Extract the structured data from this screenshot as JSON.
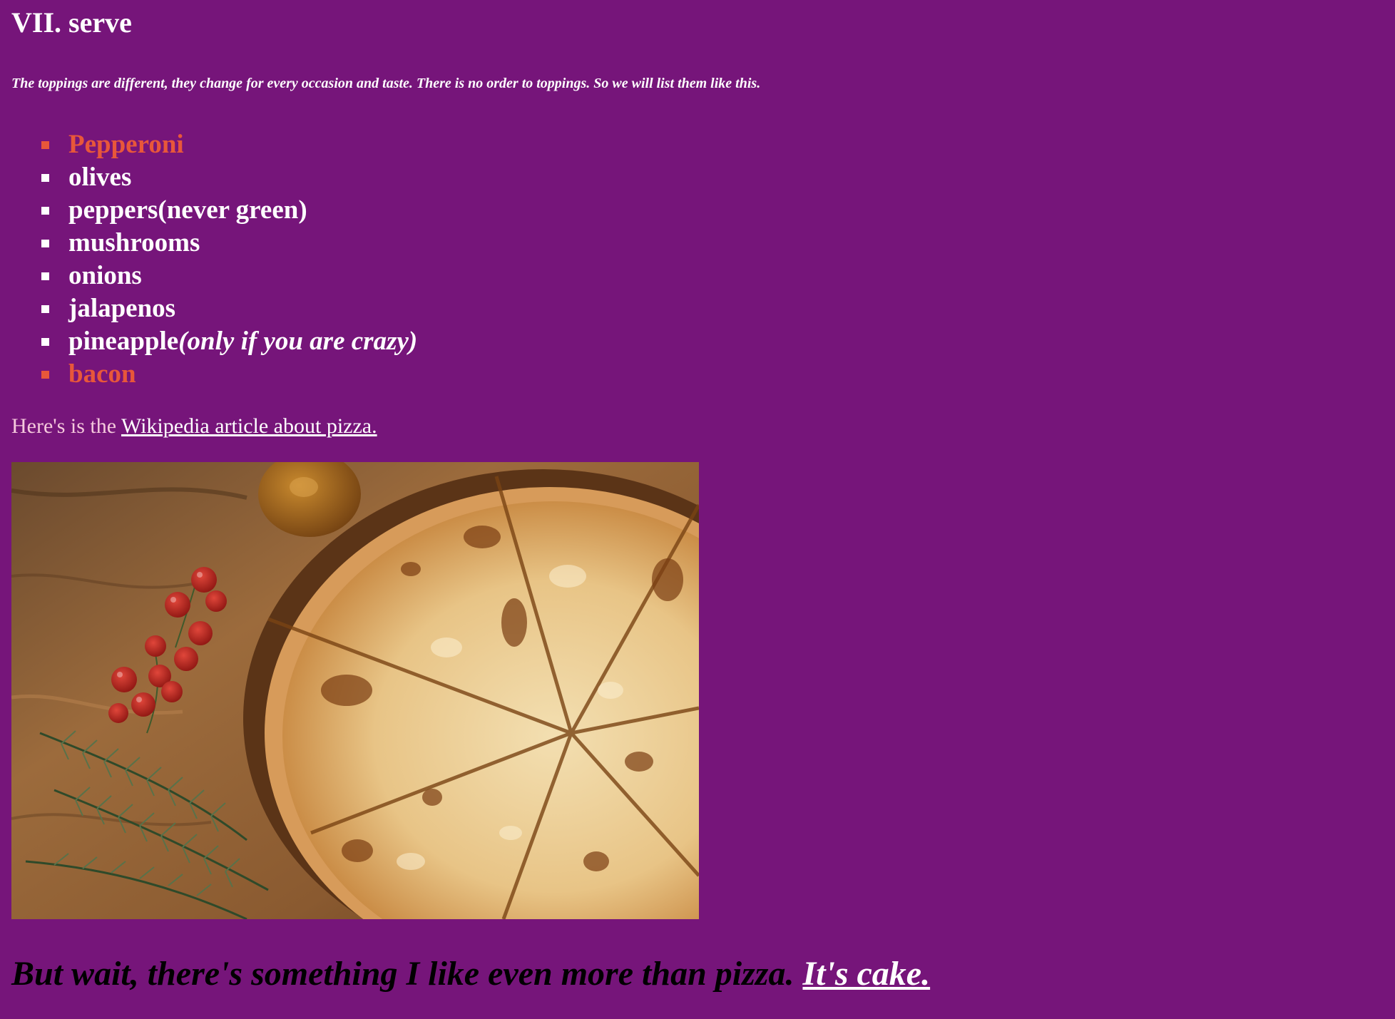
{
  "colors": {
    "background": "#76157a",
    "text": "#ffffff",
    "accent": "#e8573a",
    "muted_text": "#f5c9dc",
    "closing_text": "#000000"
  },
  "section": {
    "heading": "VII. serve",
    "intro": "The toppings are different, they change for every occasion and taste. There is no order to toppings. So we will list them like this."
  },
  "toppings": [
    {
      "label": "Pepperoni"
    },
    {
      "label": "olives"
    },
    {
      "label": "peppers(never green)"
    },
    {
      "label": "mushrooms"
    },
    {
      "label": "onions"
    },
    {
      "label": "jalapenos"
    },
    {
      "label": "pineapple",
      "note": "(only if you are crazy)"
    },
    {
      "label": "bacon"
    }
  ],
  "wiki": {
    "prefix": "Here's is the ",
    "link_text": "Wikipedia article about pizza."
  },
  "image": {
    "subject": "pizza-photo"
  },
  "closing": {
    "text": "But wait, there's something I like even more than pizza. ",
    "link_text": "It's cake."
  }
}
